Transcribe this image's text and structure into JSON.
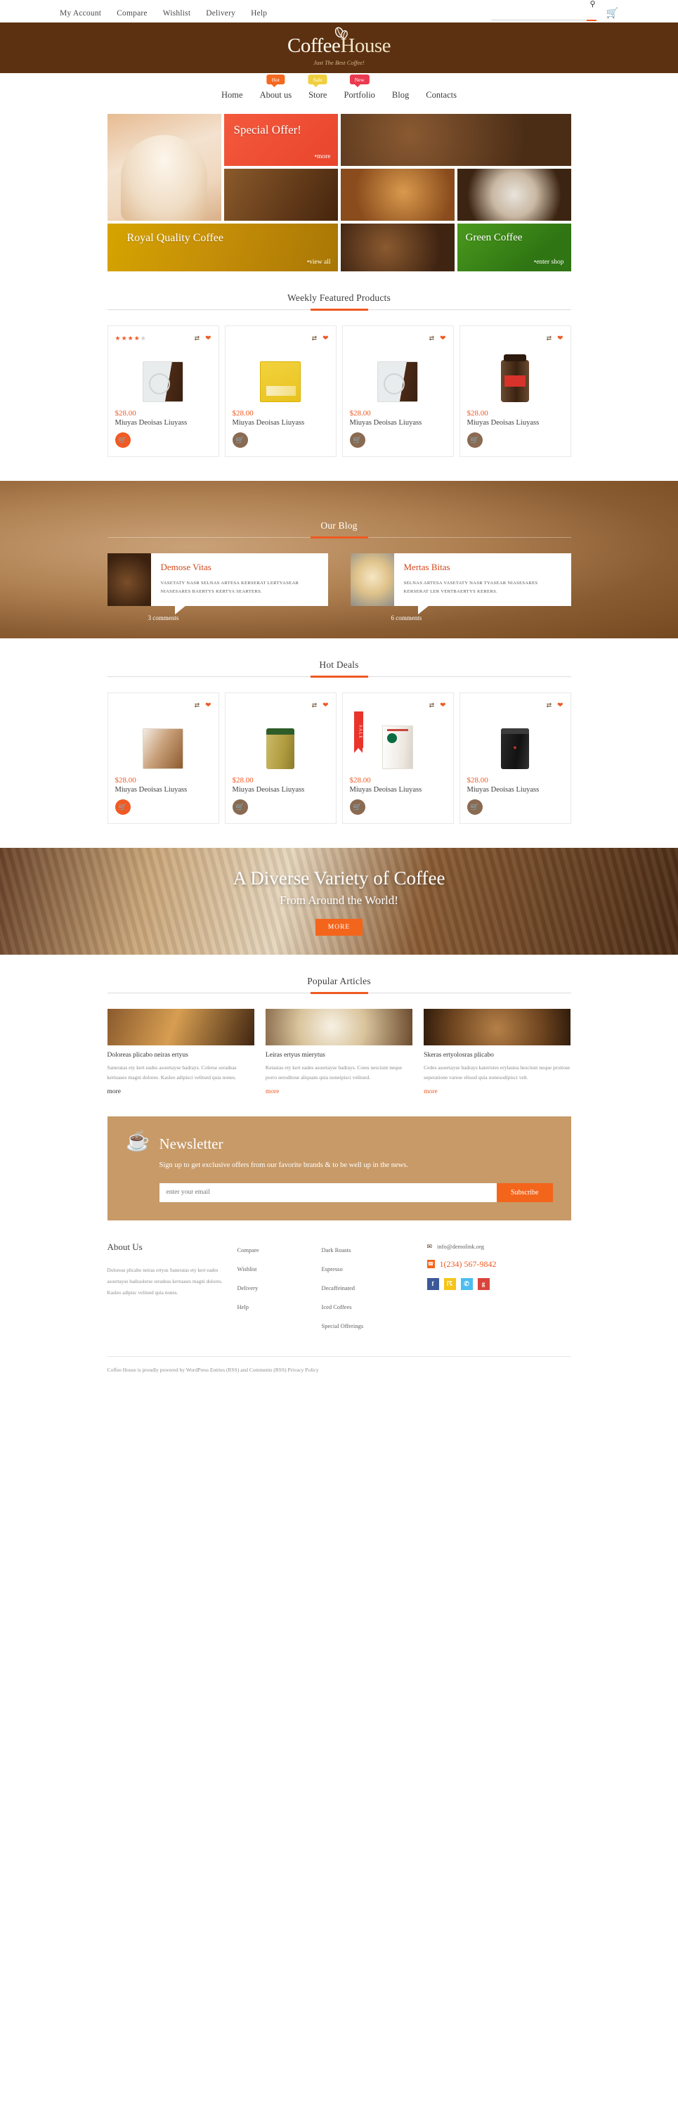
{
  "topbar": {
    "links": [
      {
        "label": "My Account"
      },
      {
        "label": "Compare"
      },
      {
        "label": "Wishlist"
      },
      {
        "label": "Delivery"
      },
      {
        "label": "Help"
      }
    ],
    "search_placeholder": "",
    "search_value": "",
    "search_icon": "search-icon",
    "cart_icon": "shopping-cart-icon"
  },
  "logo": {
    "name_part1": "Coffee",
    "name_part2": "House",
    "tagline": "Just The Best Coffee!",
    "band_color": "#5c3111"
  },
  "mainnav": [
    {
      "label": "Home",
      "badge": null,
      "badge_color": null
    },
    {
      "label": "About us",
      "badge": "Hot",
      "badge_color": "#f4691f"
    },
    {
      "label": "Store",
      "badge": "Sale",
      "badge_color": "#f0cf3f"
    },
    {
      "label": "Portfolio",
      "badge": "New",
      "badge_color": "#ea3a4f"
    },
    {
      "label": "Blog",
      "badge": null,
      "badge_color": null
    },
    {
      "label": "Contacts",
      "badge": null,
      "badge_color": null
    }
  ],
  "gallery": {
    "special": {
      "title": "Special Offer!",
      "link": "more"
    },
    "royal": {
      "title": "Royal Quality Coffee",
      "link": "view all"
    },
    "green": {
      "title": "Green Coffee",
      "link": "enter shop"
    }
  },
  "featured": {
    "heading": "Weekly Featured Products",
    "products": [
      {
        "price": "$28.00",
        "name": "Miuyas Deoisas Liuyass",
        "rating": 4,
        "has_rating": true,
        "compare_icon": "compare-icon",
        "wishlist_icon": "heart-icon",
        "cart_icon": "cart-icon"
      },
      {
        "price": "$28.00",
        "name": "Miuyas Deoisas Liuyass",
        "rating": 0,
        "has_rating": false,
        "compare_icon": "compare-icon",
        "wishlist_icon": "heart-icon",
        "cart_icon": "cart-icon"
      },
      {
        "price": "$28.00",
        "name": "Miuyas Deoisas Liuyass",
        "rating": 0,
        "has_rating": false,
        "compare_icon": "compare-icon",
        "wishlist_icon": "heart-icon",
        "cart_icon": "cart-icon"
      },
      {
        "price": "$28.00",
        "name": "Miuyas Deoisas Liuyass",
        "rating": 0,
        "has_rating": false,
        "compare_icon": "compare-icon",
        "wishlist_icon": "heart-icon",
        "cart_icon": "cart-icon"
      }
    ]
  },
  "blog": {
    "heading": "Our Blog",
    "posts": [
      {
        "title": "Demose Vitas",
        "excerpt": "VASETATY NASR SELNAS ARTESA KERSERAT LERTYASEAR NIASESARES BAERTYS KERTYA SEARTERS.",
        "comments": "3 comments"
      },
      {
        "title": "Mertas Bitas",
        "excerpt": "SELNAS ARTESA VASETATY NASR TYASEAR NIASESARES KERSERAT LER VERTBAERTYS KERERS.",
        "comments": "6 comments"
      }
    ]
  },
  "hotdeals": {
    "heading": "Hot Deals",
    "sale_label": "SALE",
    "products": [
      {
        "price": "$28.00",
        "name": "Miuyas Deoisas Liuyass",
        "sale": false
      },
      {
        "price": "$28.00",
        "name": "Miuyas Deoisas Liuyass",
        "sale": false
      },
      {
        "price": "$28.00",
        "name": "Miuyas Deoisas Liuyass",
        "sale": true
      },
      {
        "price": "$28.00",
        "name": "Miuyas Deoisas Liuyass",
        "sale": false
      }
    ]
  },
  "promo": {
    "title": "A Diverse Variety of Coffee",
    "subtitle": "From Around the World!",
    "button": "MORE"
  },
  "articles": {
    "heading": "Popular Articles",
    "items": [
      {
        "title": "Doloreas plicabo neiras ertyus",
        "text": "Saneratas ety kert eades asoertayse badrays. Colerse seradeas kertuases magni dolores. Kasleo adipisci velitsed quia nones.",
        "more": "more"
      },
      {
        "title": "Leiras ertyus mierytus",
        "text": "Ketastas ety kert eades asoertayse badrays. Cotes nesciunt neque porro seroditose aliquam quia noneipisci velitsed.",
        "more": "more"
      },
      {
        "title": "Skeras ertyolosras plicabo",
        "text": "Cedes asoertayse badrays kateristes erylastea hesciunt neque proitose seperatione varese eliuod quia nonesodipisci velt.",
        "more": "more"
      }
    ]
  },
  "newsletter": {
    "icon": "coffee-cup-icon",
    "title": "Newsletter",
    "subtitle": "Sign up to get exclusive offers from our favorite brands & to be well up in the news.",
    "input_placeholder": "enter your email",
    "input_value": "",
    "button": "Subscribe",
    "bg_color": "#c79a68"
  },
  "footer": {
    "about_title": "About Us",
    "about_text": "Doloreas plicabo neiras ertyus Saneratas ety kert eades asoertayse badraolerse seradeas kertuases magni dolores. Kasleo adipisc velitsed quia nones.",
    "col2": [
      {
        "label": "Compare"
      },
      {
        "label": "Wishlist"
      },
      {
        "label": "Delivery"
      },
      {
        "label": "Help"
      }
    ],
    "col3": [
      {
        "label": "Dark Roasts"
      },
      {
        "label": "Espresso"
      },
      {
        "label": "Decaffeinated"
      },
      {
        "label": "Iced Coffees"
      },
      {
        "label": "Special Offerings"
      }
    ],
    "email": "info@demolink.org",
    "email_icon": "envelope-icon",
    "phone": "1(234) 567-9842",
    "phone_icon": "phone-icon",
    "socials": [
      {
        "name": "facebook-icon",
        "glyph": "f",
        "color": "#3b5998"
      },
      {
        "name": "rss-icon",
        "glyph": "☈",
        "color": "#f5c518"
      },
      {
        "name": "twitter-icon",
        "glyph": "✆",
        "color": "#4bbdf0"
      },
      {
        "name": "google-plus-icon",
        "glyph": "g",
        "color": "#d9453b"
      }
    ],
    "copyright": "Coffee House is proudly powered by WordPress Entries (RSS) and Comments (RSS) Privacy Policy"
  }
}
